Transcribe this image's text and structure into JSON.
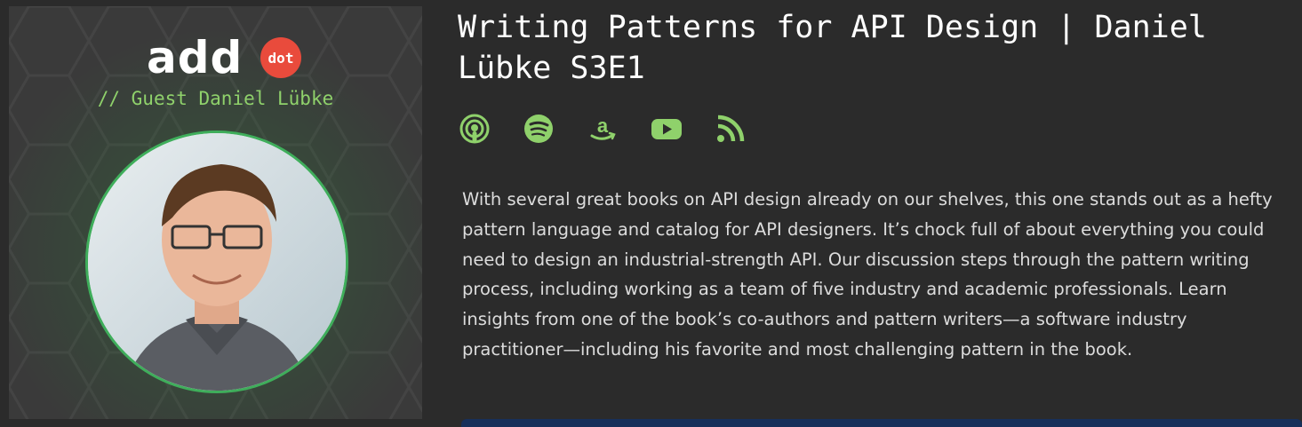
{
  "cover": {
    "logo_text": "add",
    "logo_badge": "dot",
    "guest_line": "// Guest Daniel Lübke",
    "avatar_alt": "Daniel Lübke"
  },
  "episode": {
    "title": "Writing Patterns for API Design | Daniel Lübke S3E1",
    "description": "With several great books on API design already on our shelves, this one stands out as a hefty pattern language and catalog for API designers. It’s chock full of about everything you could need to design an industrial-strength API. Our discussion steps through the pattern writing process, including working as a team of five industry and academic professionals. Learn insights from one of the book’s co-authors and pattern writers—a software industry practitioner—including his favorite and most challenging pattern in the book."
  },
  "platforms": [
    {
      "name": "apple-podcasts",
      "icon": "podcast-icon"
    },
    {
      "name": "spotify",
      "icon": "spotify-icon"
    },
    {
      "name": "amazon-music",
      "icon": "amazon-icon"
    },
    {
      "name": "youtube",
      "icon": "youtube-icon"
    },
    {
      "name": "rss",
      "icon": "rss-icon"
    }
  ],
  "colors": {
    "background": "#2b2b2b",
    "accent_green": "#8fd16b",
    "logo_red": "#e94b3c",
    "avatar_ring": "#3fae5b"
  }
}
